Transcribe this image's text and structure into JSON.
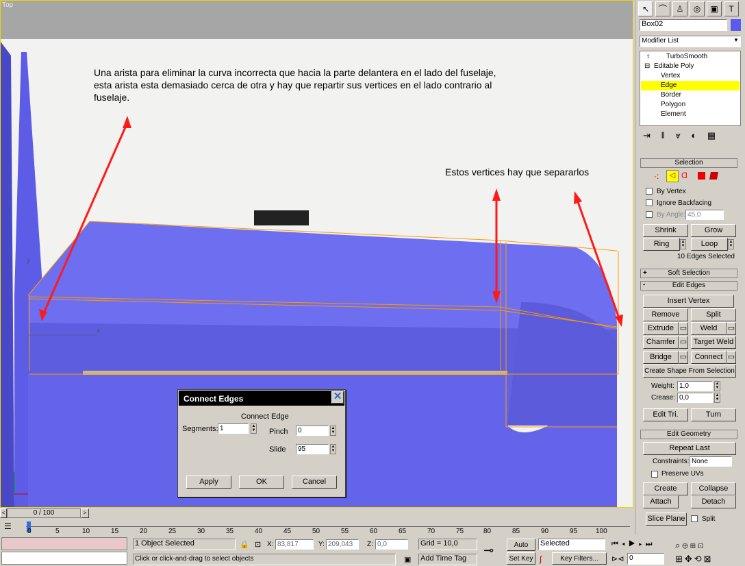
{
  "viewport": {
    "label": "Top",
    "note_left": "Una arista para eliminar la curva incorrecta que hacia la parte delantera en el lado del fuselaje, esta arista esta demasiado cerca de otra y hay que repartir sus vertices en el lado contrario al fuselaje.",
    "note_right": "Estos vertices hay que separarlos",
    "axis_x": "x",
    "axis_y": "y",
    "colors": {
      "model": "#6e6ef0",
      "edge": "#ff9900",
      "arrow": "#ff1a1a"
    }
  },
  "dialog": {
    "title": "Connect Edges",
    "section": "Connect Edge",
    "segments_label": "Segments:",
    "segments_value": "1",
    "pinch_label": "Pinch",
    "pinch_value": "0",
    "slide_label": "Slide",
    "slide_value": "95",
    "apply": "Apply",
    "ok": "OK",
    "cancel": "Cancel"
  },
  "panel": {
    "object_name": "Box02",
    "object_color": "#5a5af0",
    "modifier_list": "Modifier List",
    "stack": [
      "TurboSmooth",
      "Editable Poly",
      "Vertex",
      "Edge",
      "Border",
      "Polygon",
      "Element"
    ],
    "selection": {
      "title": "Selection",
      "by_vertex": "By Vertex",
      "ignore_backfacing": "Ignore Backfacing",
      "by_angle": "By Angle:",
      "angle_value": "45,0",
      "shrink": "Shrink",
      "grow": "Grow",
      "ring": "Ring",
      "loop": "Loop",
      "status": "10 Edges Selected"
    },
    "soft_selection": "Soft Selection",
    "edit_edges": {
      "title": "Edit Edges",
      "insert_vertex": "Insert Vertex",
      "remove": "Remove",
      "split": "Split",
      "extrude": "Extrude",
      "weld": "Weld",
      "chamfer": "Chamfer",
      "target_weld": "Target Weld",
      "bridge": "Bridge",
      "connect": "Connect",
      "create_shape": "Create Shape From Selection",
      "weight_label": "Weight:",
      "weight_value": "1,0",
      "crease_label": "Crease:",
      "crease_value": "0,0",
      "edit_tri": "Edit Tri.",
      "turn": "Turn"
    },
    "edit_geometry": {
      "title": "Edit Geometry",
      "repeat_last": "Repeat Last",
      "constraints_label": "Constraints:",
      "constraints_value": "None",
      "preserve_uvs": "Preserve UVs",
      "create": "Create",
      "collapse": "Collapse",
      "attach": "Attach",
      "detach": "Detach",
      "slice_plane": "Slice Plane",
      "split": "Split"
    }
  },
  "timeline": {
    "frame": "0 / 100",
    "ticks": [
      "0",
      "5",
      "10",
      "15",
      "20",
      "25",
      "30",
      "35",
      "40",
      "45",
      "50",
      "55",
      "60",
      "65",
      "70",
      "75",
      "80",
      "85",
      "90",
      "95",
      "100"
    ]
  },
  "status": {
    "selection": "1 Object Selected",
    "prompt": "Click or click-and-drag to select objects",
    "x_label": "X:",
    "x_value": "83,817",
    "y_label": "Y:",
    "y_value": "209,043",
    "z_label": "Z:",
    "z_value": "0,0",
    "grid": "Grid = 10,0",
    "add_time_tag": "Add Time Tag",
    "auto_key": "Auto Key",
    "set_key": "Set Key",
    "selected": "Selected",
    "key_filters": "Key Filters...",
    "frame_value": "0"
  }
}
